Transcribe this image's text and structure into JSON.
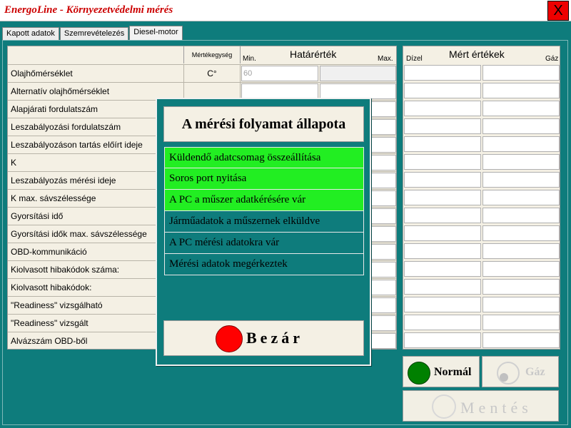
{
  "window": {
    "title": "EnergoLine  -  Környezetvédelmi mérés",
    "close_label": "X"
  },
  "tabs": [
    {
      "label": "Kapott adatok",
      "active": false
    },
    {
      "label": "Szemrevételezés",
      "active": false
    },
    {
      "label": "Diesel-motor",
      "active": true
    }
  ],
  "table": {
    "unit_header": "Mértékegység",
    "min_header": "Min.",
    "limit_header": "Határérték",
    "max_header": "Max.",
    "measured_header": "Mért értékek",
    "diesel_header": "Dízel",
    "gas_header": "Gáz",
    "rows": [
      {
        "name": "Olajhőmérséklet",
        "unit": "C°",
        "min": "60",
        "max": ""
      },
      {
        "name": "Alternatív olajhőmérséklet",
        "unit": "",
        "min": "",
        "max": ""
      },
      {
        "name": "Alapjárati fordulatszám",
        "unit": "",
        "min": "",
        "max": ""
      },
      {
        "name": "Leszabályozási fordulatszám",
        "unit": "",
        "min": "",
        "max": ""
      },
      {
        "name": "Leszabályozáson tartás előírt ideje",
        "unit": "",
        "min": "",
        "max": ""
      },
      {
        "name": "K",
        "unit": "",
        "min": "",
        "max": ""
      },
      {
        "name": "Leszabályozás mérési ideje",
        "unit": "",
        "min": "",
        "max": ""
      },
      {
        "name": "K max. sávszélessége",
        "unit": "",
        "min": "",
        "max": ""
      },
      {
        "name": "Gyorsítási idő",
        "unit": "",
        "min": "",
        "max": ""
      },
      {
        "name": "Gyorsítási idők max. sávszélessége",
        "unit": "",
        "min": "",
        "max": ""
      },
      {
        "name": "OBD-kommunikáció",
        "unit": "",
        "min": "",
        "max": ""
      },
      {
        "name": "Kiolvasott hibakódok száma:",
        "unit": "",
        "min": "",
        "max": ""
      },
      {
        "name": "Kiolvasott hibakódok:",
        "unit": "",
        "min": "",
        "max": ""
      },
      {
        "name": "\"Readiness\" vizsgálható",
        "unit": "",
        "min": "",
        "max": ""
      },
      {
        "name": "\"Readiness\" vizsgált",
        "unit": "",
        "min": "",
        "max": ""
      },
      {
        "name": "Alvázszám OBD-ből",
        "unit": "",
        "min": "",
        "max": ""
      }
    ]
  },
  "fuel_buttons": [
    {
      "label": "Normál",
      "lamp_color": "#008000",
      "active": true
    },
    {
      "label": "Gáz",
      "lamp_color": "#f2efe4",
      "active": false
    }
  ],
  "save_button": {
    "label": "Mentés"
  },
  "modal": {
    "title": "A mérési folyamat állapota",
    "steps": [
      {
        "label": "Küldendő adatcsomag összeállítása",
        "done": true
      },
      {
        "label": "Soros port nyitása",
        "done": true
      },
      {
        "label": "A PC a műszer adatkérésére vár",
        "done": true
      },
      {
        "label": "Járműadatok a műszernek elküldve",
        "done": false
      },
      {
        "label": "A PC mérési adatokra vár",
        "done": false
      },
      {
        "label": "Mérési adatok megérkeztek",
        "done": false
      }
    ],
    "close_label": "Bezár"
  },
  "colors": {
    "background": "#0e7c7c",
    "step_done": "#22ee22",
    "close_lamp": "#ff0000",
    "title_text": "#cc0000"
  }
}
